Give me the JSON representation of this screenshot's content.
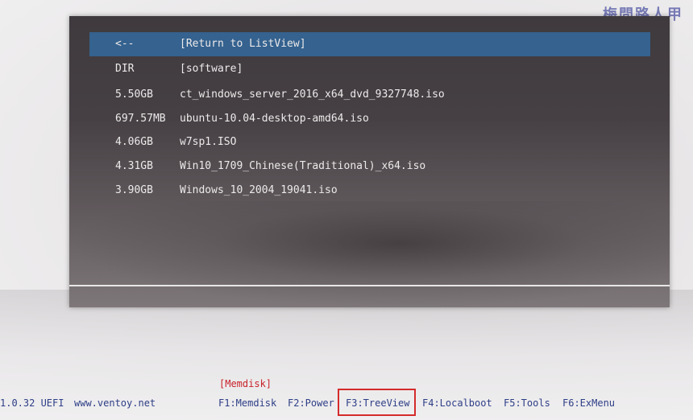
{
  "watermark": "梅問路人甲",
  "list": {
    "rows": [
      {
        "size": "<--",
        "name": "[Return to ListView]",
        "selected": true
      },
      {
        "size": "DIR",
        "name": "[software]"
      },
      {
        "size": "5.50GB",
        "name": "ct_windows_server_2016_x64_dvd_9327748.iso"
      },
      {
        "size": "697.57MB",
        "name": "ubuntu-10.04-desktop-amd64.iso"
      },
      {
        "size": "4.06GB",
        "name": "w7sp1.ISO"
      },
      {
        "size": "4.31GB",
        "name": "Win10_1709_Chinese(Traditional)_x64.iso"
      },
      {
        "size": "3.90GB",
        "name": "Windows_10_2004_19041.iso"
      }
    ]
  },
  "status": {
    "version": "1.0.32 UEFI",
    "website": "www.ventoy.net",
    "memdisk_tag": "[Memdisk]",
    "keys": {
      "f1": "F1:Memdisk",
      "f2": "F2:Power",
      "f3": "F3:TreeView",
      "f4": "F4:Localboot",
      "f5": "F5:Tools",
      "f6": "F6:ExMenu"
    }
  },
  "colors": {
    "selection": "#35628f",
    "status_text": "#2d3e86",
    "accent_red": "#c8232a"
  }
}
